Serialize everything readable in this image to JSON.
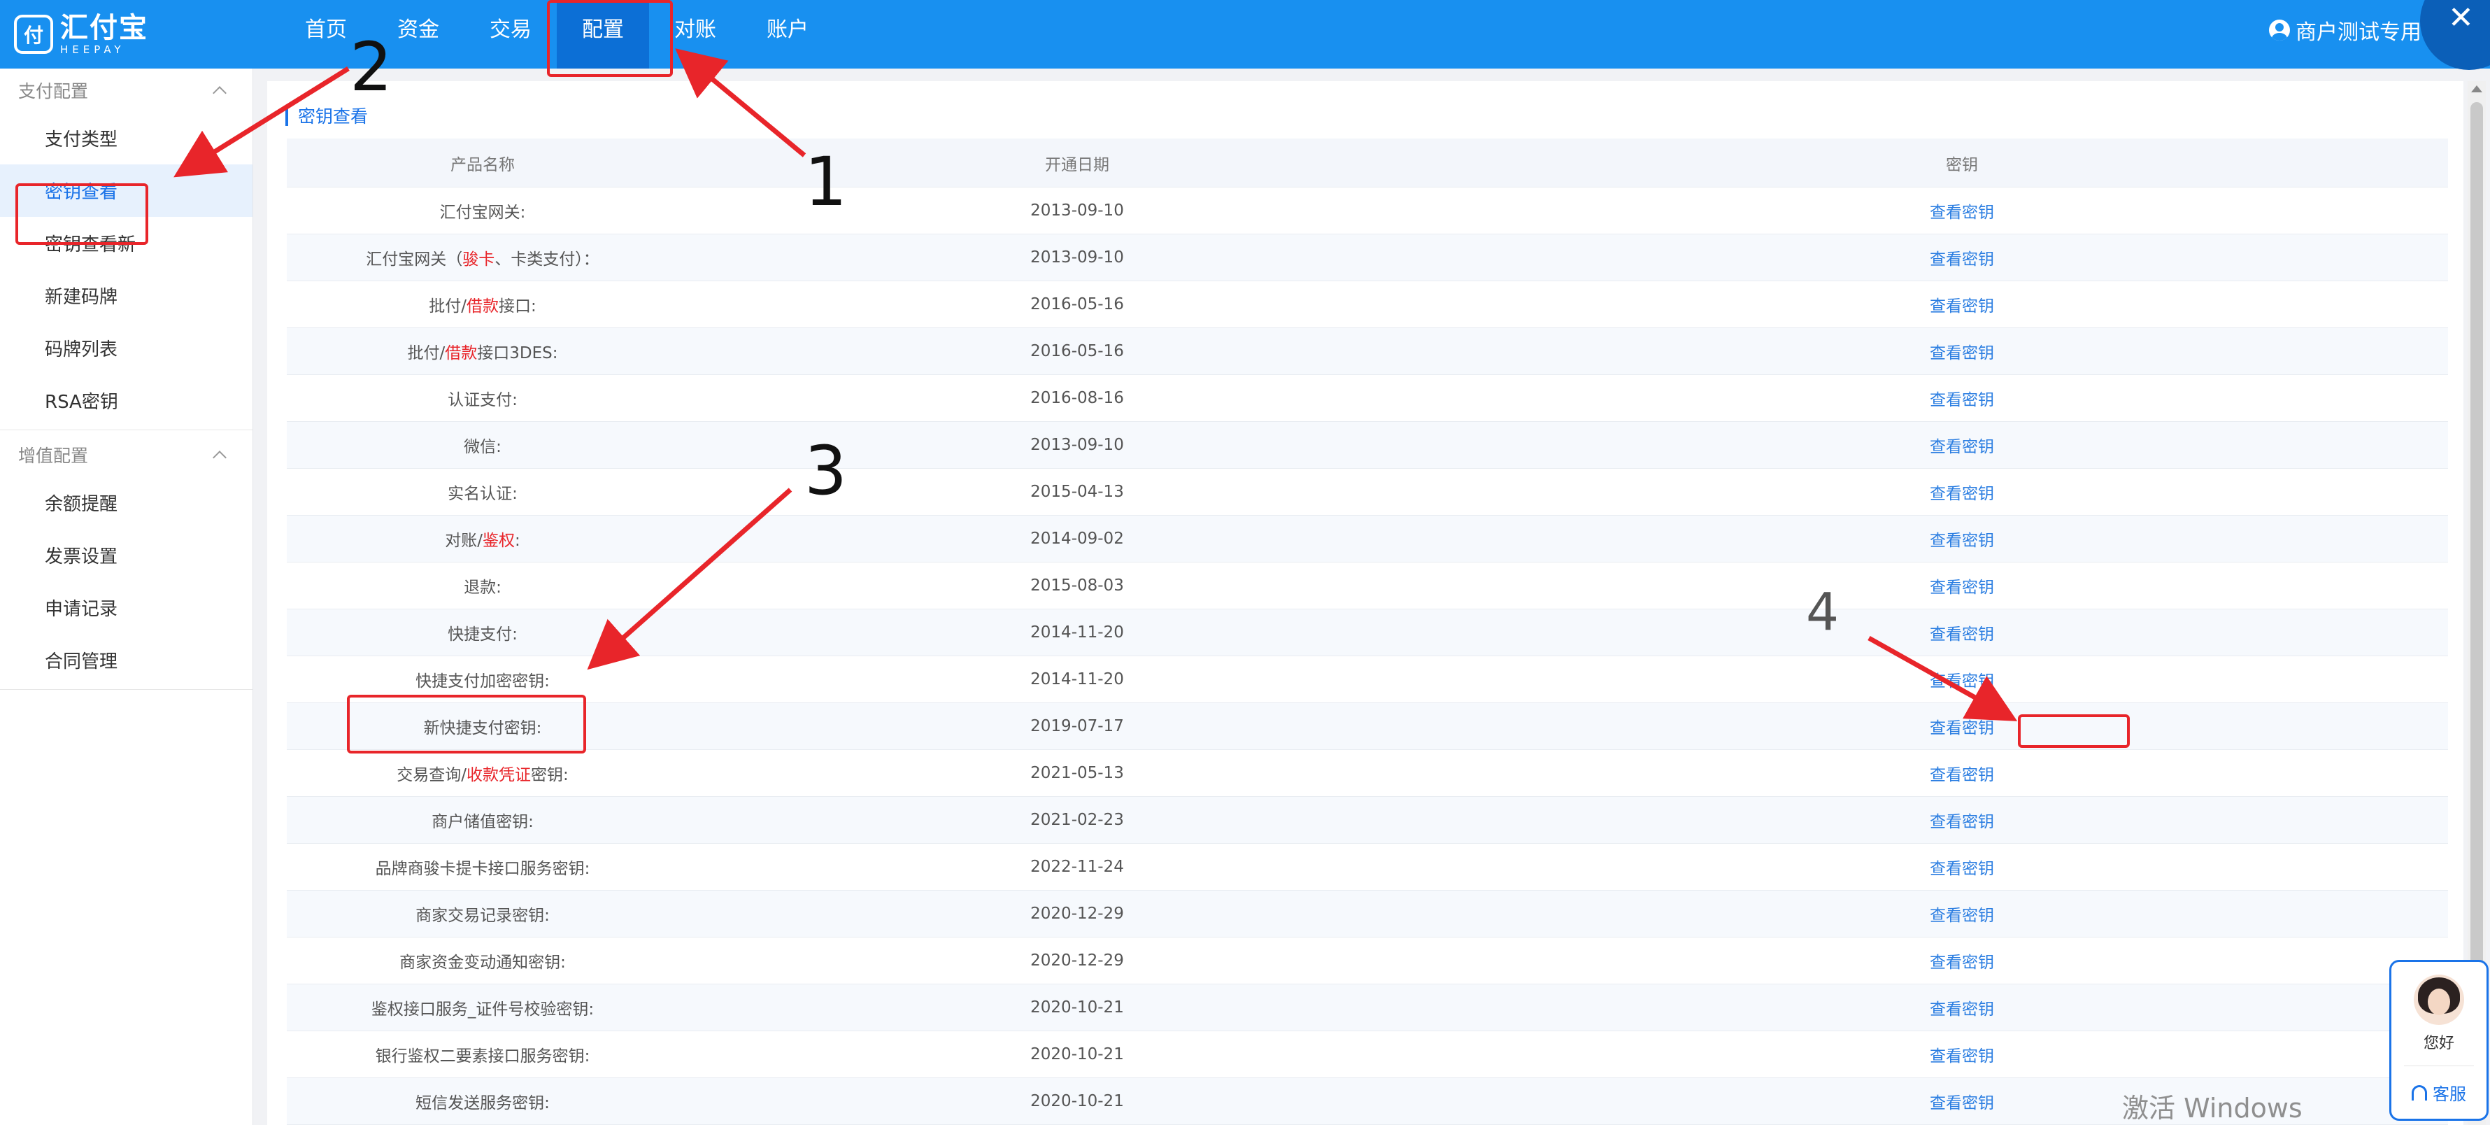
{
  "brand": {
    "logo_mark": "付",
    "name": "汇付宝",
    "name_en": "HEEPAY"
  },
  "nav": [
    {
      "label": "首页"
    },
    {
      "label": "资金"
    },
    {
      "label": "交易"
    },
    {
      "label": "配置",
      "active": true
    },
    {
      "label": "对账"
    },
    {
      "label": "账户"
    }
  ],
  "user": {
    "label": "商户测试专用号码"
  },
  "close_glyph": "✕",
  "sidebar": {
    "groups": [
      {
        "title": "支付配置",
        "items": [
          {
            "label": "支付类型"
          },
          {
            "label": "密钥查看",
            "active": true
          },
          {
            "label": "密钥查看新"
          },
          {
            "label": "新建码牌"
          },
          {
            "label": "码牌列表"
          },
          {
            "label": "RSA密钥"
          }
        ]
      },
      {
        "title": "增值配置",
        "items": [
          {
            "label": "余额提醒"
          },
          {
            "label": "发票设置"
          },
          {
            "label": "申请记录"
          },
          {
            "label": "合同管理"
          }
        ]
      }
    ]
  },
  "main": {
    "section_title": "密钥查看",
    "table": {
      "headers": [
        "产品名称",
        "开通日期",
        "密钥"
      ],
      "rows": [
        {
          "name": [
            "汇付宝网关:"
          ],
          "date": "2013-09-10",
          "action": "查看密钥"
        },
        {
          "name": [
            "汇付宝网关（",
            {
              "hl": "骏卡"
            },
            "、卡类支付）："
          ],
          "date": "2013-09-10",
          "action": "查看密钥"
        },
        {
          "name": [
            "批付/",
            {
              "hl": "借款"
            },
            "接口:"
          ],
          "date": "2016-05-16",
          "action": "查看密钥"
        },
        {
          "name": [
            "批付/",
            {
              "hl": "借款"
            },
            "接口3DES:"
          ],
          "date": "2016-05-16",
          "action": "查看密钥"
        },
        {
          "name": [
            "认证支付:"
          ],
          "date": "2016-08-16",
          "action": "查看密钥"
        },
        {
          "name": [
            "微信:"
          ],
          "date": "2013-09-10",
          "action": "查看密钥"
        },
        {
          "name": [
            "实名认证:"
          ],
          "date": "2015-04-13",
          "action": "查看密钥"
        },
        {
          "name": [
            "对账/",
            {
              "hl": "鉴权"
            },
            ":"
          ],
          "date": "2014-09-02",
          "action": "查看密钥"
        },
        {
          "name": [
            "退款:"
          ],
          "date": "2015-08-03",
          "action": "查看密钥"
        },
        {
          "name": [
            "快捷支付:"
          ],
          "date": "2014-11-20",
          "action": "查看密钥"
        },
        {
          "name": [
            "快捷支付加密密钥:"
          ],
          "date": "2014-11-20",
          "action": "查看密钥"
        },
        {
          "name": [
            "新快捷支付密钥:"
          ],
          "date": "2019-07-17",
          "action": "查看密钥"
        },
        {
          "name": [
            "交易查询/",
            {
              "hl": "收款凭证"
            },
            "密钥:"
          ],
          "date": "2021-05-13",
          "action": "查看密钥"
        },
        {
          "name": [
            "商户储值密钥:"
          ],
          "date": "2021-02-23",
          "action": "查看密钥"
        },
        {
          "name": [
            "品牌商骏卡提卡接口服务密钥:"
          ],
          "date": "2022-11-24",
          "action": "查看密钥"
        },
        {
          "name": [
            "商家交易记录密钥:"
          ],
          "date": "2020-12-29",
          "action": "查看密钥"
        },
        {
          "name": [
            "商家资金变动通知密钥:"
          ],
          "date": "2020-12-29",
          "action": "查看密钥"
        },
        {
          "name": [
            "鉴权接口服务_证件号校验密钥:"
          ],
          "date": "2020-10-21",
          "action": "查看密钥"
        },
        {
          "name": [
            "银行鉴权二要素接口服务密钥:"
          ],
          "date": "2020-10-21",
          "action": "查看密钥"
        },
        {
          "name": [
            "短信发送服务密钥:"
          ],
          "date": "2020-10-21",
          "action": "查看密钥"
        }
      ]
    }
  },
  "service_widget": {
    "greeting": "您好",
    "button": "客服"
  },
  "watermark": "激活 Windows",
  "annotations": {
    "n1": "1",
    "n2": "2",
    "n3": "3",
    "n4": "4"
  },
  "colors": {
    "topbar": "#1890f0",
    "accent": "#1a73e8",
    "annotation": "#e8252a"
  }
}
